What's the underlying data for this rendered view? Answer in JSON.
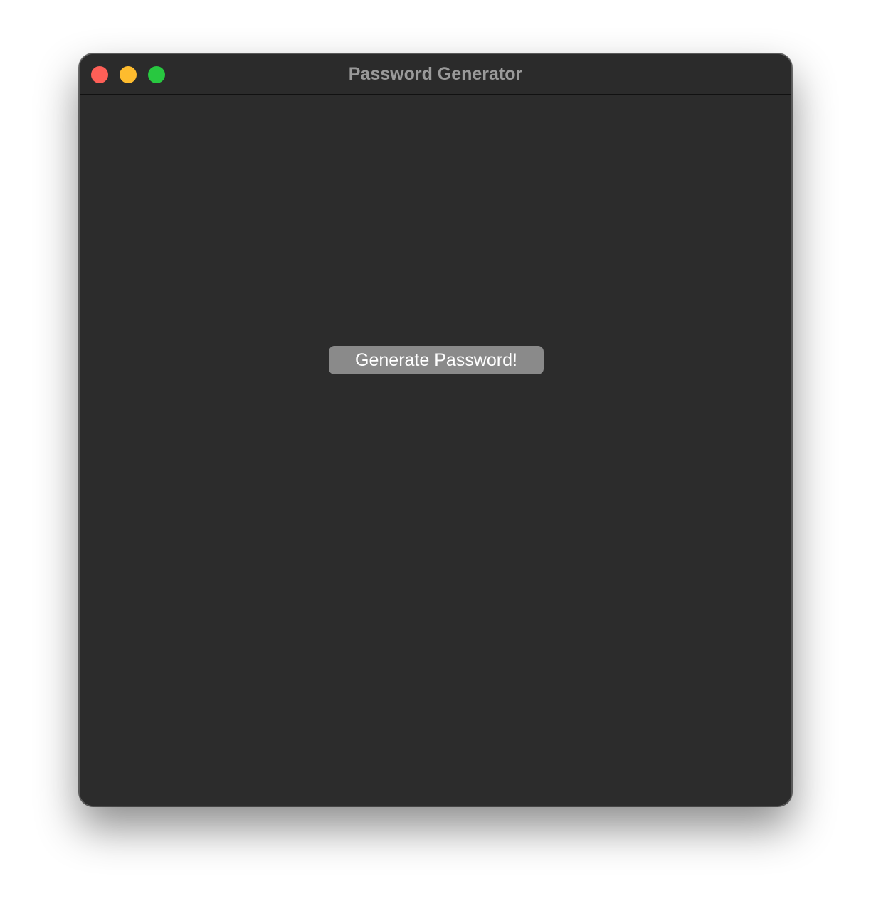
{
  "window": {
    "title": "Password Generator",
    "controls": {
      "close_icon": "close-traffic-light-icon",
      "minimize_icon": "minimize-traffic-light-icon",
      "zoom_icon": "zoom-traffic-light-icon",
      "close_color": "#fe5f57",
      "minimize_color": "#febc2e",
      "zoom_color": "#28c840"
    },
    "background_color": "#2c2c2c"
  },
  "main": {
    "generate_button_label": "Generate Password!",
    "button_color": "#8a8a8a"
  }
}
